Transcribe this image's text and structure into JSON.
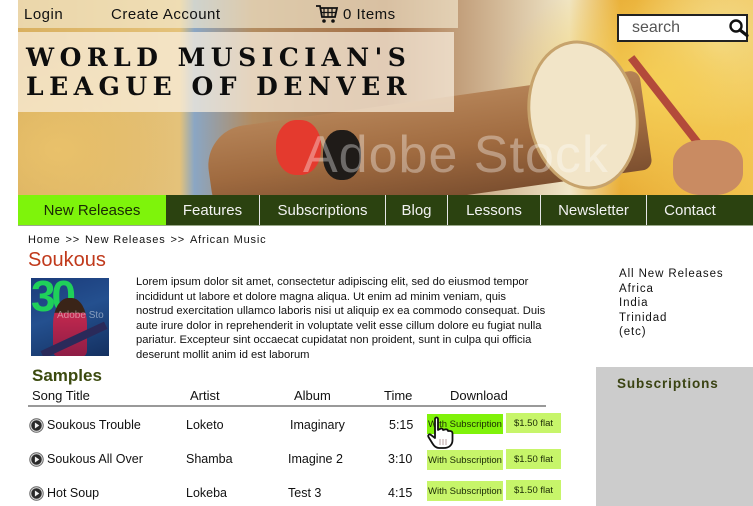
{
  "topbar": {
    "login": "Login",
    "create_account": "Create Account",
    "cart_count": "0 Items"
  },
  "site_title": {
    "line1": "World Musician's",
    "line2": "League of Denver"
  },
  "hero": {
    "watermark": "Adobe Stock"
  },
  "search": {
    "placeholder": "search"
  },
  "nav": {
    "items": [
      {
        "label": "New Releases",
        "active": true
      },
      {
        "label": "Features"
      },
      {
        "label": "Subscriptions"
      },
      {
        "label": "Blog"
      },
      {
        "label": "Lessons"
      },
      {
        "label": "Newsletter"
      },
      {
        "label": "Contact"
      }
    ]
  },
  "breadcrumb": {
    "items": [
      "Home",
      "New Releases",
      "African Music"
    ],
    "separator": ">>"
  },
  "page": {
    "title": "Soukous",
    "album_art_text": "30",
    "album_art_watermark": "Adobe Sto",
    "description": "Lorem ipsum dolor sit amet, consectetur adipiscing elit, sed do eiusmod tempor incididunt ut labore et dolore magna aliqua. Ut enim ad minim veniam, quis nostrud exercitation ullamco laboris nisi ut aliquip ex ea commodo consequat. Duis aute irure dolor in reprehenderit in voluptate velit esse cillum dolore eu fugiat nulla pariatur. Excepteur sint occaecat cupidatat non proident, sunt in culpa qui officia deserunt mollit anim id est laborum"
  },
  "sidebar": {
    "links": [
      "All New Releases",
      "Africa",
      "India",
      "Trinidad",
      "(etc)"
    ],
    "subscriptions_title": "Subscriptions"
  },
  "samples": {
    "title": "Samples",
    "columns": [
      "Song Title",
      "Artist",
      "Album",
      "Time",
      "Download"
    ],
    "rows": [
      {
        "title": "Soukous Trouble",
        "artist": "Loketo",
        "album": "Imaginary",
        "time": "5:15",
        "sub_label": "With Subscription",
        "flat_label": "$1.50 flat"
      },
      {
        "title": "Soukous All Over",
        "artist": "Shamba",
        "album": "Imagine 2",
        "time": "3:10",
        "sub_label": "With Subscription",
        "flat_label": "$1.50 flat"
      },
      {
        "title": "Hot Soup",
        "artist": "Lokeba",
        "album": "Test 3",
        "time": "4:15",
        "sub_label": "With Subscription",
        "flat_label": "$1.50 flat"
      }
    ]
  },
  "colors": {
    "nav_bg": "#2b4210",
    "nav_active": "#7ef40b",
    "title_red": "#c0391b",
    "button_green": "#c7f56a",
    "button_hover_green": "#80f20a",
    "sidebar_box": "#cccccc"
  }
}
